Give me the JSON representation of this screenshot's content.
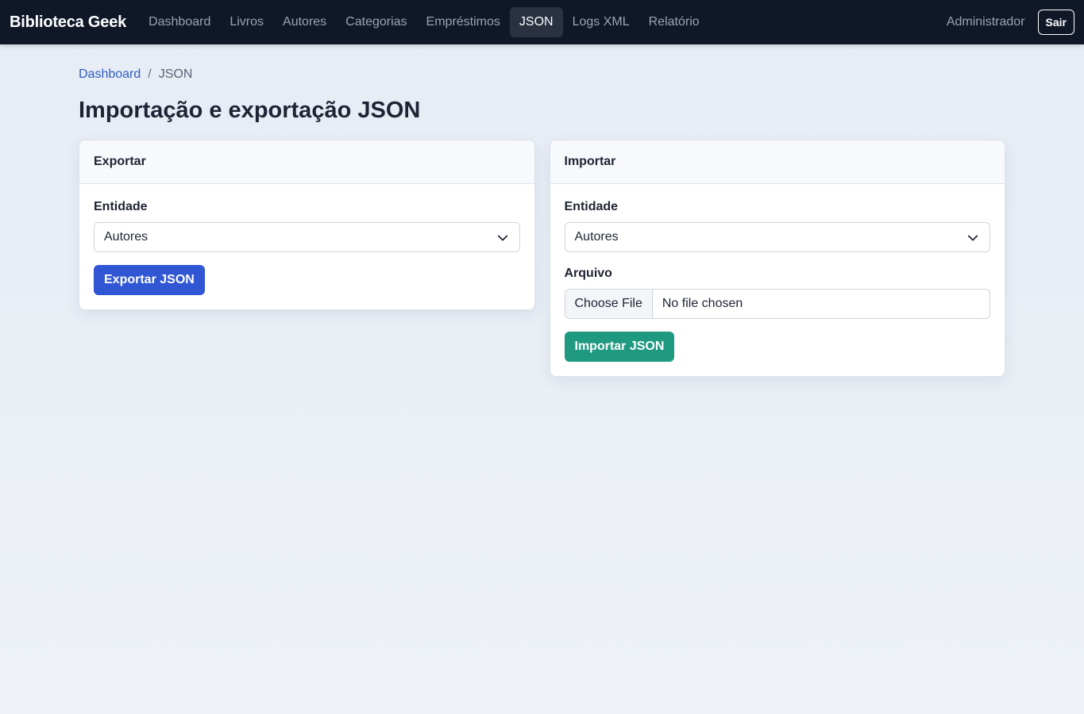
{
  "navbar": {
    "brand": "Biblioteca Geek",
    "links": [
      {
        "label": "Dashboard"
      },
      {
        "label": "Livros"
      },
      {
        "label": "Autores"
      },
      {
        "label": "Categorias"
      },
      {
        "label": "Empréstimos"
      },
      {
        "label": "JSON"
      },
      {
        "label": "Logs XML"
      },
      {
        "label": "Relatório"
      }
    ],
    "active_link": "JSON",
    "user": "Administrador",
    "logout_label": "Sair"
  },
  "breadcrumb": {
    "items": [
      "Dashboard",
      "JSON"
    ],
    "separator": "/"
  },
  "page_title": "Importação e exportação JSON",
  "export_card": {
    "title": "Exportar",
    "entity_label": "Entidade",
    "entity_value": "Autores",
    "button_label": "Exportar JSON"
  },
  "import_card": {
    "title": "Importar",
    "entity_label": "Entidade",
    "entity_value": "Autores",
    "file_label": "Arquivo",
    "file_button": "Choose File",
    "file_status": "No file chosen",
    "button_label": "Importar JSON"
  },
  "colors": {
    "navbar_bg": "#101828",
    "accent_blue": "#3056d3",
    "accent_green": "#1f9a80",
    "link": "#2f5ec4"
  }
}
